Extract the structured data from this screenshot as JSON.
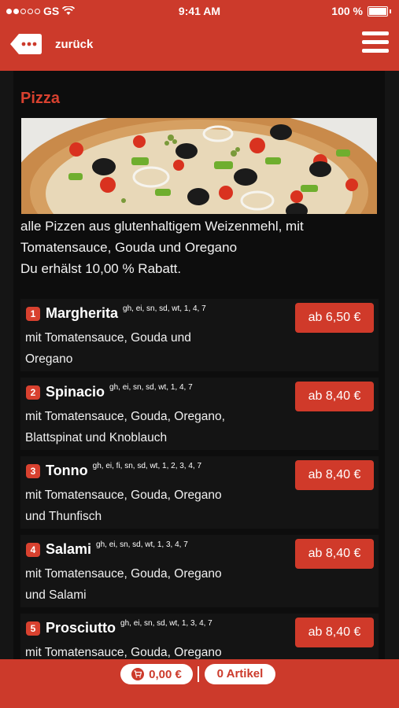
{
  "status_bar": {
    "carrier": "GS",
    "time": "9:41 AM",
    "battery": "100 %"
  },
  "header": {
    "back_label": "zurück",
    "menu_icon": "hamburger-icon",
    "back_icon": "back-dots-icon"
  },
  "section": {
    "title": "Pizza",
    "description_line1": "alle Pizzen aus glutenhaltigem Weizenmehl, mit",
    "description_line2": "Tomatensauce, Gouda und Oregano",
    "discount": "Du erhälst 10,00 % Rabatt."
  },
  "items": [
    {
      "number": "1",
      "name": "Margherita",
      "allergens": "gh, ei, sn, sd, wt, 1, 4, 7",
      "desc1": "mit Tomatensauce, Gouda und",
      "desc2": "Oregano",
      "price": "ab 6,50 €"
    },
    {
      "number": "2",
      "name": "Spinacio",
      "allergens": "gh, ei, sn, sd, wt, 1, 4, 7",
      "desc1": "mit Tomatensauce, Gouda, Oregano,",
      "desc2": "Blattspinat und Knoblauch",
      "price": "ab 8,40 €"
    },
    {
      "number": "3",
      "name": "Tonno",
      "allergens": "gh, ei, fi, sn, sd, wt, 1, 2, 3, 4, 7",
      "desc1": "mit Tomatensauce, Gouda, Oregano",
      "desc2": "und Thunfisch",
      "price": "ab 8,40 €"
    },
    {
      "number": "4",
      "name": "Salami",
      "allergens": "gh, ei, sn, sd, wt, 1, 3, 4, 7",
      "desc1": "mit Tomatensauce, Gouda, Oregano",
      "desc2": "und Salami",
      "price": "ab 8,40 €"
    },
    {
      "number": "5",
      "name": "Prosciutto",
      "allergens": "gh, ei, sn, sd, wt, 1, 3, 4, 7",
      "desc1": "mit Tomatensauce, Gouda, Oregano",
      "desc2": "",
      "price": "ab 8,40 €"
    }
  ],
  "footer": {
    "cart_total": "0,00 €",
    "item_count": "0 Artikel",
    "cart_icon": "cart-icon"
  },
  "colors": {
    "brand_red": "#cc3a2b",
    "accent_red": "#d8412f",
    "background": "#0d0d0d"
  }
}
